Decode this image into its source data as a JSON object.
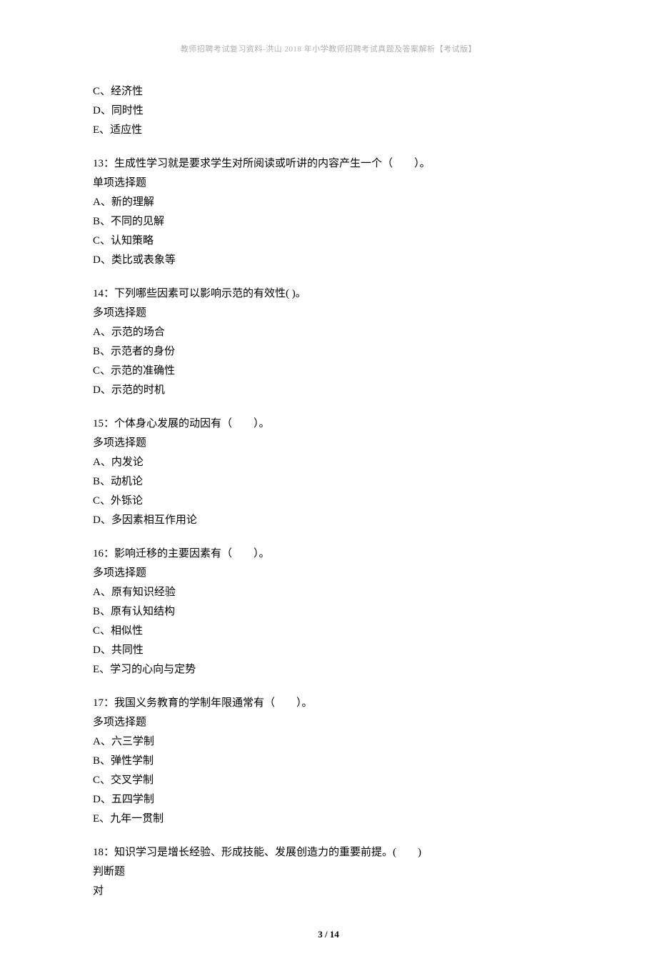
{
  "header": {
    "title": "教师招聘考试复习资料-洪山 2018 年小学教师招聘考试真题及答案解析【考试版】"
  },
  "q12_partial": {
    "optC": "C、经济性",
    "optD": "D、同时性",
    "optE": "E、适应性"
  },
  "q13": {
    "text": "13：生成性学习就是要求学生对所阅读或听讲的内容产生一个（　　）。",
    "type": "单项选择题",
    "optA": "A、新的理解",
    "optB": "B、不同的见解",
    "optC": "C、认知策略",
    "optD": "D、类比或表象等"
  },
  "q14": {
    "text": "14：下列哪些因素可以影响示范的有效性( )。",
    "type": "多项选择题",
    "optA": "A、示范的场合",
    "optB": "B、示范者的身份",
    "optC": "C、示范的准确性",
    "optD": "D、示范的时机"
  },
  "q15": {
    "text": "15：个体身心发展的动因有（　　）。",
    "type": "多项选择题",
    "optA": "A、内发论",
    "optB": "B、动机论",
    "optC": "C、外铄论",
    "optD": "D、多因素相互作用论"
  },
  "q16": {
    "text": "16：影响迁移的主要因素有（　　）。",
    "type": "多项选择题",
    "optA": "A、原有知识经验",
    "optB": "B、原有认知结构",
    "optC": "C、相似性",
    "optD": "D、共同性",
    "optE": "E、学习的心向与定势"
  },
  "q17": {
    "text": "17：我国义务教育的学制年限通常有（　　）。",
    "type": "多项选择题",
    "optA": "A、六三学制",
    "optB": "B、弹性学制",
    "optC": "C、交叉学制",
    "optD": "D、五四学制",
    "optE": "E、九年一贯制"
  },
  "q18": {
    "text": "18：知识学习是增长经验、形成技能、发展创造力的重要前提。(　　)",
    "type": "判断题",
    "optA": "对"
  },
  "footer": {
    "page": "3 / 14"
  }
}
